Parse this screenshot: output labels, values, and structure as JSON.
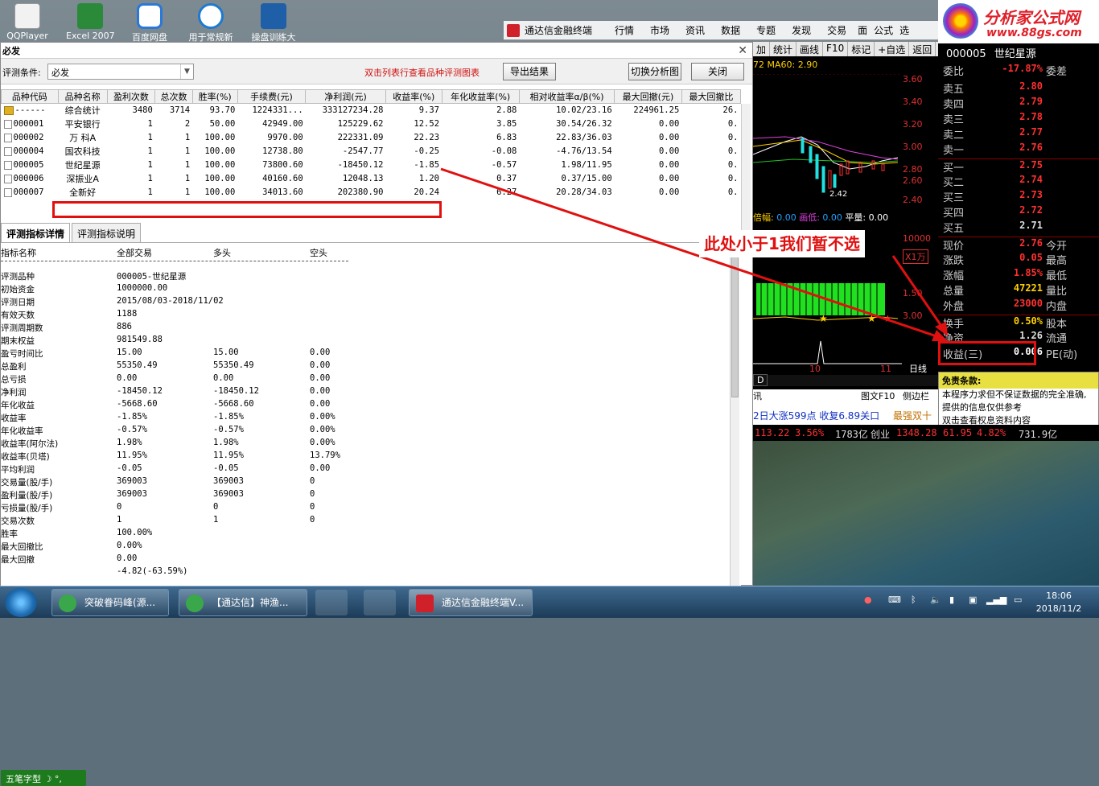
{
  "desktop": {
    "icons": [
      {
        "label": "QQPlayer",
        "color": "#e8e8e8"
      },
      {
        "label": "Excel 2007",
        "color": "#2a8a3a"
      },
      {
        "label": "百度网盘",
        "color": "#2a78d8"
      },
      {
        "label": "用于常规新",
        "color": "#1e7ad0"
      },
      {
        "label": "操盘训练大",
        "color": "#1f5fa8"
      }
    ]
  },
  "tdx_menu": {
    "title": "通达信金融终端",
    "items": [
      "行情",
      "市场",
      "资讯",
      "数据",
      "专题",
      "发现",
      "交易",
      "面",
      "公式",
      "选"
    ]
  },
  "brand": {
    "title": "分析家公式网",
    "url": "www.88gs.com"
  },
  "window": {
    "title": "必发",
    "cond_label": "评测条件:",
    "cond_value": "必发",
    "hint": "双击列表行查看品种评测图表",
    "btn_export": "导出结果",
    "btn_switch": "切换分析图",
    "btn_close": "关闭",
    "columns": [
      "品种代码",
      "品种名称",
      "盈利次数",
      "总次数",
      "胜率(%)",
      "手续费(元)",
      "净利润(元)",
      "收益率(%)",
      "年化收益率(%)",
      "相对收益率α/β(%)",
      "最大回撤(元)",
      "最大回撤比"
    ],
    "rows": [
      [
        "------",
        "综合统计",
        "3480",
        "3714",
        "93.70",
        "1224331...",
        "333127234.28",
        "9.37",
        "2.88",
        "10.02/23.16",
        "224961.25",
        "26."
      ],
      [
        "000001",
        "平安银行",
        "1",
        "2",
        "50.00",
        "42949.00",
        "125229.62",
        "12.52",
        "3.85",
        "30.54/26.32",
        "0.00",
        "0."
      ],
      [
        "000002",
        "万 科A",
        "1",
        "1",
        "100.00",
        "9970.00",
        "222331.09",
        "22.23",
        "6.83",
        "22.83/36.03",
        "0.00",
        "0."
      ],
      [
        "000004",
        "国农科技",
        "1",
        "1",
        "100.00",
        "12738.80",
        "-2547.77",
        "-0.25",
        "-0.08",
        "-4.76/13.54",
        "0.00",
        "0."
      ],
      [
        "000005",
        "世纪星源",
        "1",
        "1",
        "100.00",
        "73800.60",
        "-18450.12",
        "-1.85",
        "-0.57",
        "1.98/11.95",
        "0.00",
        "0."
      ],
      [
        "000006",
        "深振业A",
        "1",
        "1",
        "100.00",
        "40160.60",
        "12048.13",
        "1.20",
        "0.37",
        "0.37/15.00",
        "0.00",
        "0."
      ],
      [
        "000007",
        "全新好",
        "1",
        "1",
        "100.00",
        "34013.60",
        "202380.90",
        "20.24",
        "6.27",
        "20.28/34.03",
        "0.00",
        "0."
      ]
    ],
    "tabs": [
      "评测指标详情",
      "评测指标说明"
    ],
    "detail_headers": [
      "指标名称",
      "全部交易",
      "多头",
      "空头"
    ],
    "detail_rows": [
      [
        "评测品种",
        "000005-世纪星源",
        "",
        ""
      ],
      [
        "初始资金",
        "1000000.00",
        "",
        ""
      ],
      [
        "评测日期",
        "2015/08/03-2018/11/02",
        "",
        ""
      ],
      [
        "有效天数",
        "1188",
        "",
        ""
      ],
      [
        "评测周期数",
        "886",
        "",
        ""
      ],
      [
        "期末权益",
        "981549.88",
        "",
        ""
      ],
      [
        "盈亏时间比",
        "15.00",
        "15.00",
        "0.00"
      ],
      [
        "总盈利",
        "55350.49",
        "55350.49",
        "0.00"
      ],
      [
        "总亏损",
        "0.00",
        "0.00",
        "0.00"
      ],
      [
        "净利润",
        "-18450.12",
        "-18450.12",
        "0.00"
      ],
      [
        "年化收益",
        "-5668.60",
        "-5668.60",
        "0.00"
      ],
      [
        "收益率",
        "-1.85%",
        "-1.85%",
        "0.00%"
      ],
      [
        "年化收益率",
        "-0.57%",
        "-0.57%",
        "0.00%"
      ],
      [
        "收益率(阿尔法)",
        "1.98%",
        "1.98%",
        "0.00%"
      ],
      [
        "收益率(贝塔)",
        "11.95%",
        "11.95%",
        "13.79%"
      ],
      [
        "平均利润",
        "-0.05",
        "-0.05",
        "0.00"
      ],
      [
        "交易量(股/手)",
        "369003",
        "369003",
        "0"
      ],
      [
        "盈利量(股/手)",
        "369003",
        "369003",
        "0"
      ],
      [
        "亏损量(股/手)",
        "0",
        "0",
        "0"
      ],
      [
        "交易次数",
        "1",
        "1",
        "0"
      ],
      [
        "胜率",
        "100.00%",
        "",
        ""
      ],
      [
        "最大回撤比",
        "0.00%",
        "",
        ""
      ],
      [
        "最大回撤",
        "0.00",
        "",
        ""
      ],
      [
        "",
        "-4.82(-63.59%)",
        "",
        ""
      ]
    ],
    "ime": "五笔字型"
  },
  "chart": {
    "toolbar": [
      "加",
      "统计",
      "画线",
      "F10",
      "标记",
      "+自选",
      "返回"
    ],
    "ma_text": "72  MA60: 2.90",
    "prices": [
      "3.60",
      "3.40",
      "3.20",
      "3.00",
      "2.80",
      "2.60",
      "2.40"
    ],
    "low_label": "2.42",
    "vol_text": "倍幅: 0.00  画低: 0.00  平量: 0.00",
    "vol_ticks": [
      "10000",
      "X1万"
    ],
    "sub_ticks": [
      "1.50",
      "3.00"
    ],
    "date_ticks": [
      "10",
      "11"
    ],
    "footer": [
      "日线",
      "D",
      "讯",
      "图文F10",
      "侧边栏"
    ],
    "news": "2日大涨599点 收复6.89关口",
    "news2": "最强双十一"
  },
  "quote": {
    "code": "000005",
    "name": "世纪星源",
    "rows": [
      {
        "k": "委比",
        "v": "-17.87%",
        "k2": "委差"
      },
      {
        "k": "卖五",
        "v": "2.80",
        "k2": ""
      },
      {
        "k": "卖四",
        "v": "2.79",
        "k2": ""
      },
      {
        "k": "卖三",
        "v": "2.78",
        "k2": ""
      },
      {
        "k": "卖二",
        "v": "2.77",
        "k2": ""
      },
      {
        "k": "卖一",
        "v": "2.76",
        "k2": ""
      },
      {
        "k": "买一",
        "v": "2.75",
        "k2": ""
      },
      {
        "k": "买二",
        "v": "2.74",
        "k2": ""
      },
      {
        "k": "买三",
        "v": "2.73",
        "k2": ""
      },
      {
        "k": "买四",
        "v": "2.72",
        "k2": ""
      },
      {
        "k": "买五",
        "v": "2.71",
        "k2": ""
      },
      {
        "k": "现价",
        "v": "2.76",
        "k2": "今开"
      },
      {
        "k": "涨跌",
        "v": "0.05",
        "k2": "最高"
      },
      {
        "k": "涨幅",
        "v": "1.85%",
        "k2": "最低"
      },
      {
        "k": "总量",
        "v": "47221",
        "k2": "量比"
      },
      {
        "k": "外盘",
        "v": "23000",
        "k2": "内盘"
      },
      {
        "k": "换手",
        "v": "0.50%",
        "k2": "股本"
      },
      {
        "k": "净资",
        "v": "1.26",
        "k2": "流通"
      },
      {
        "k": "收益(三)",
        "v": "0.006",
        "k2": "PE(动)"
      }
    ],
    "disclaimer_title": "免责条款:",
    "disclaimer_lines": [
      "本程序力求但不保证数据的完全准确,",
      "提供的信息仅供参考",
      "双击查看权息资料内容"
    ]
  },
  "index_bar": [
    "113.22",
    "3.56%",
    "1783亿",
    "创业",
    "1348.28",
    "61.95",
    "4.82%",
    "731.9亿"
  ],
  "annotation": "此处小于1我们暂不选",
  "taskbar": {
    "buttons": [
      "突破眷码峰(源...",
      "【通达信】神渔...",
      "通达信金融终端V..."
    ],
    "time": "18:06",
    "date": "2018/11/2"
  },
  "colors": {
    "accent_red": "#e01010",
    "up": "#ff3030",
    "down": "#20e020"
  }
}
